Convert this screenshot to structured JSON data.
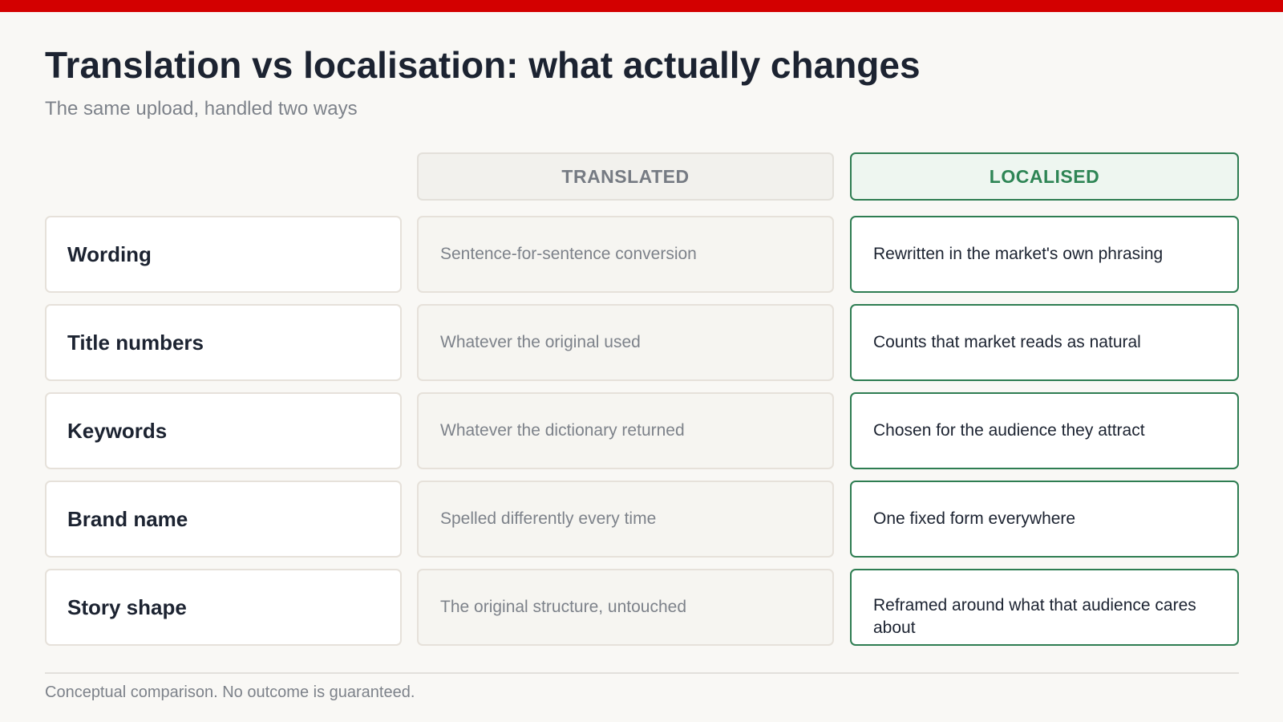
{
  "page": {
    "title": "Translation vs localisation: what actually changes",
    "subtitle": "The same upload, handled two ways",
    "footnote": "Conceptual comparison. No outcome is guaranteed."
  },
  "columns": {
    "translated": "TRANSLATED",
    "localised": "LOCALISED"
  },
  "rows": [
    {
      "label": "Wording",
      "translated": "Sentence-for-sentence conversion",
      "localised": "Rewritten in the market's own phrasing"
    },
    {
      "label": "Title numbers",
      "translated": "Whatever the original used",
      "localised": "Counts that market reads as natural"
    },
    {
      "label": "Keywords",
      "translated": "Whatever the dictionary returned",
      "localised": "Chosen for the audience they attract"
    },
    {
      "label": "Brand name",
      "translated": "Spelled differently every time",
      "localised": "One fixed form everywhere"
    },
    {
      "label": "Story shape",
      "translated": "The original structure, untouched",
      "localised": "Reframed around what that audience cares about"
    }
  ],
  "colors": {
    "accent_bar": "#d30000",
    "localised_green": "#2e7d52",
    "title_text": "#1c2331",
    "muted_text": "#7d828a"
  }
}
